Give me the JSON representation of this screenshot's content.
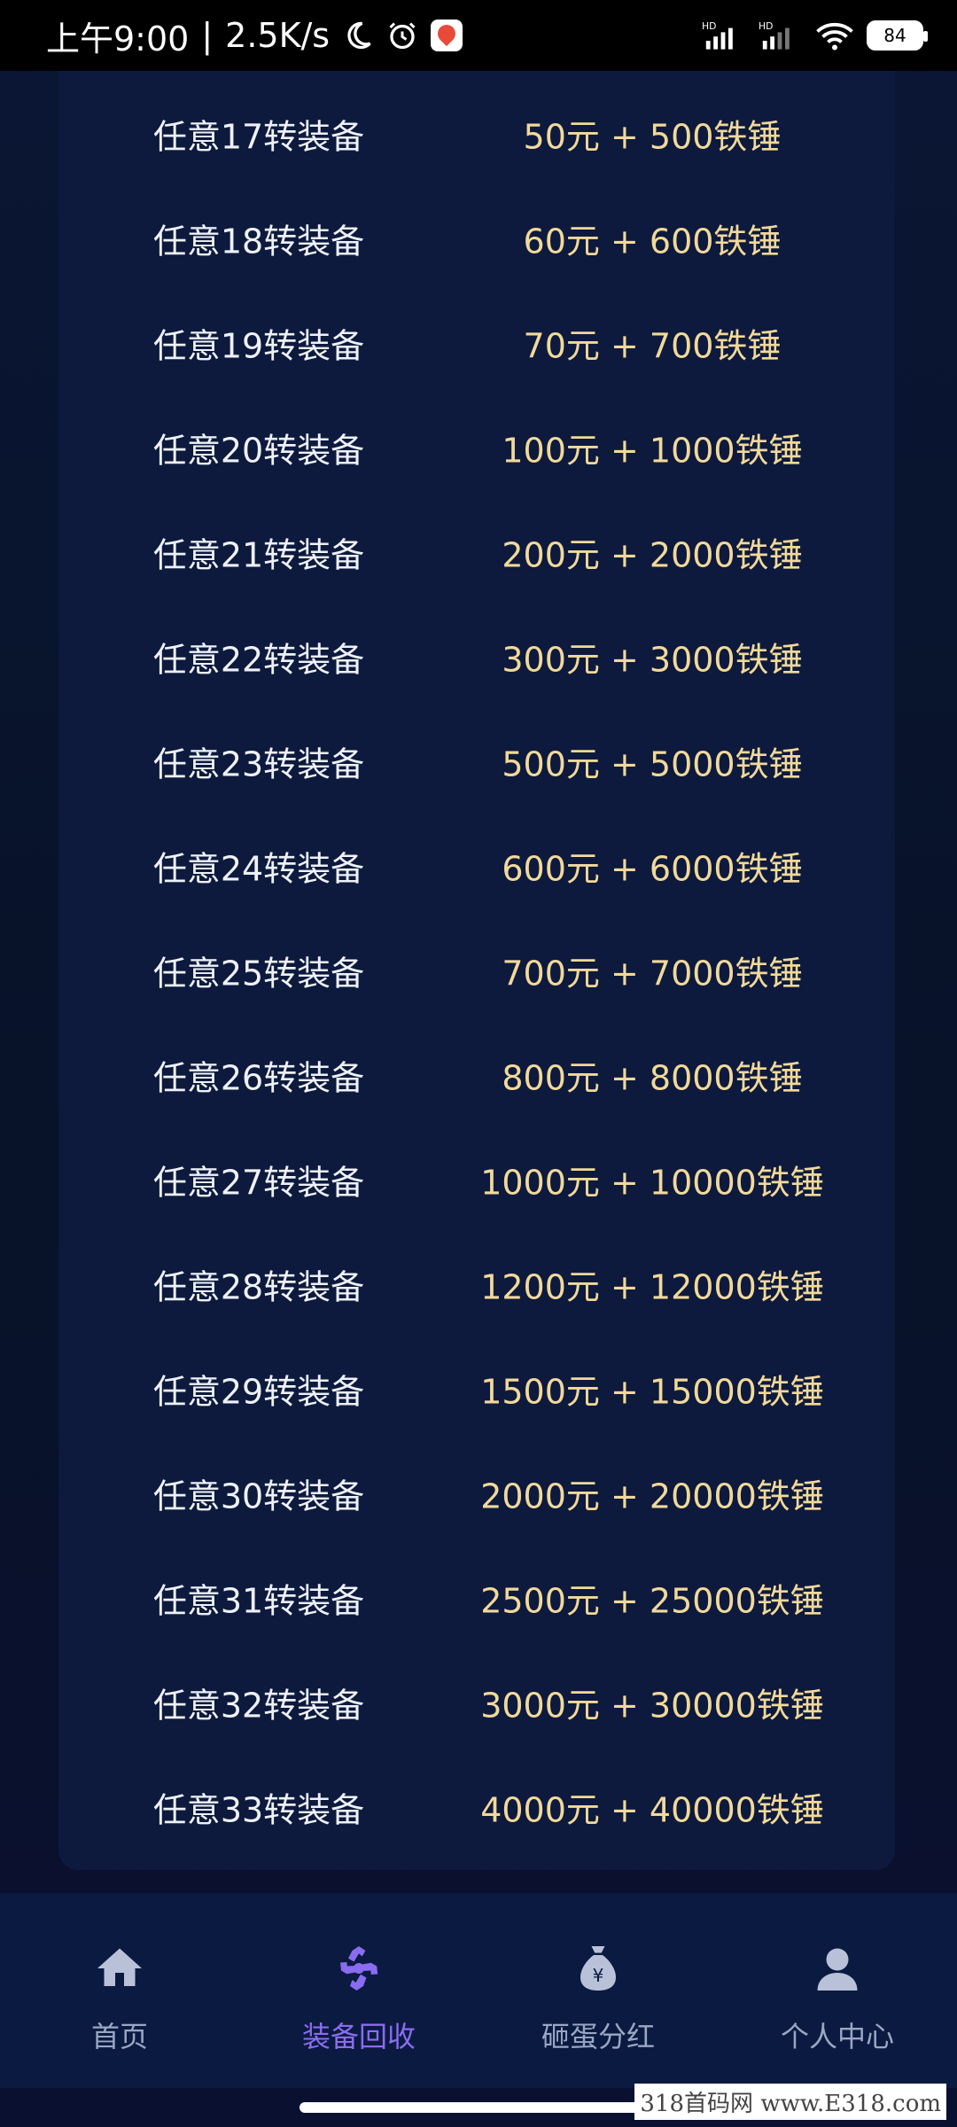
{
  "status_bar": {
    "time": "上午9:00",
    "network_speed": "2.5K/s",
    "battery_level": "84",
    "icons": [
      "moon-icon",
      "alarm-icon",
      "app-badge-icon",
      "hd-signal-icon",
      "hd-signal-icon-2",
      "wifi-icon",
      "battery-icon"
    ]
  },
  "rewards": [
    {
      "label": "任意17转装备",
      "price": "50元 + 500铁锤"
    },
    {
      "label": "任意18转装备",
      "price": "60元 + 600铁锤"
    },
    {
      "label": "任意19转装备",
      "price": "70元 + 700铁锤"
    },
    {
      "label": "任意20转装备",
      "price": "100元 + 1000铁锤"
    },
    {
      "label": "任意21转装备",
      "price": "200元 + 2000铁锤"
    },
    {
      "label": "任意22转装备",
      "price": "300元 + 3000铁锤"
    },
    {
      "label": "任意23转装备",
      "price": "500元 + 5000铁锤"
    },
    {
      "label": "任意24转装备",
      "price": "600元 + 6000铁锤"
    },
    {
      "label": "任意25转装备",
      "price": "700元 + 7000铁锤"
    },
    {
      "label": "任意26转装备",
      "price": "800元 + 8000铁锤"
    },
    {
      "label": "任意27转装备",
      "price": "1000元 + 10000铁锤"
    },
    {
      "label": "任意28转装备",
      "price": "1200元 + 12000铁锤"
    },
    {
      "label": "任意29转装备",
      "price": "1500元 + 15000铁锤"
    },
    {
      "label": "任意30转装备",
      "price": "2000元 + 20000铁锤"
    },
    {
      "label": "任意31转装备",
      "price": "2500元 + 25000铁锤"
    },
    {
      "label": "任意32转装备",
      "price": "3000元 + 30000铁锤"
    },
    {
      "label": "任意33转装备",
      "price": "4000元 + 40000铁锤"
    }
  ],
  "bottom_nav": {
    "items": [
      {
        "label": "首页",
        "icon": "home-icon",
        "active": false
      },
      {
        "label": "装备回收",
        "icon": "recycle-icon",
        "active": true
      },
      {
        "label": "砸蛋分红",
        "icon": "money-bag-icon",
        "active": false
      },
      {
        "label": "个人中心",
        "icon": "user-icon",
        "active": false
      }
    ]
  },
  "watermark": "318首码网 www.E318.com",
  "colors": {
    "label_text": "#eef1f8",
    "price_text": "#f2d99a",
    "active_nav": "#8a6cf0",
    "inactive_nav": "#9aa6c4",
    "card_bg": "#0d1a3d",
    "nav_bg": "#0b1a40"
  }
}
